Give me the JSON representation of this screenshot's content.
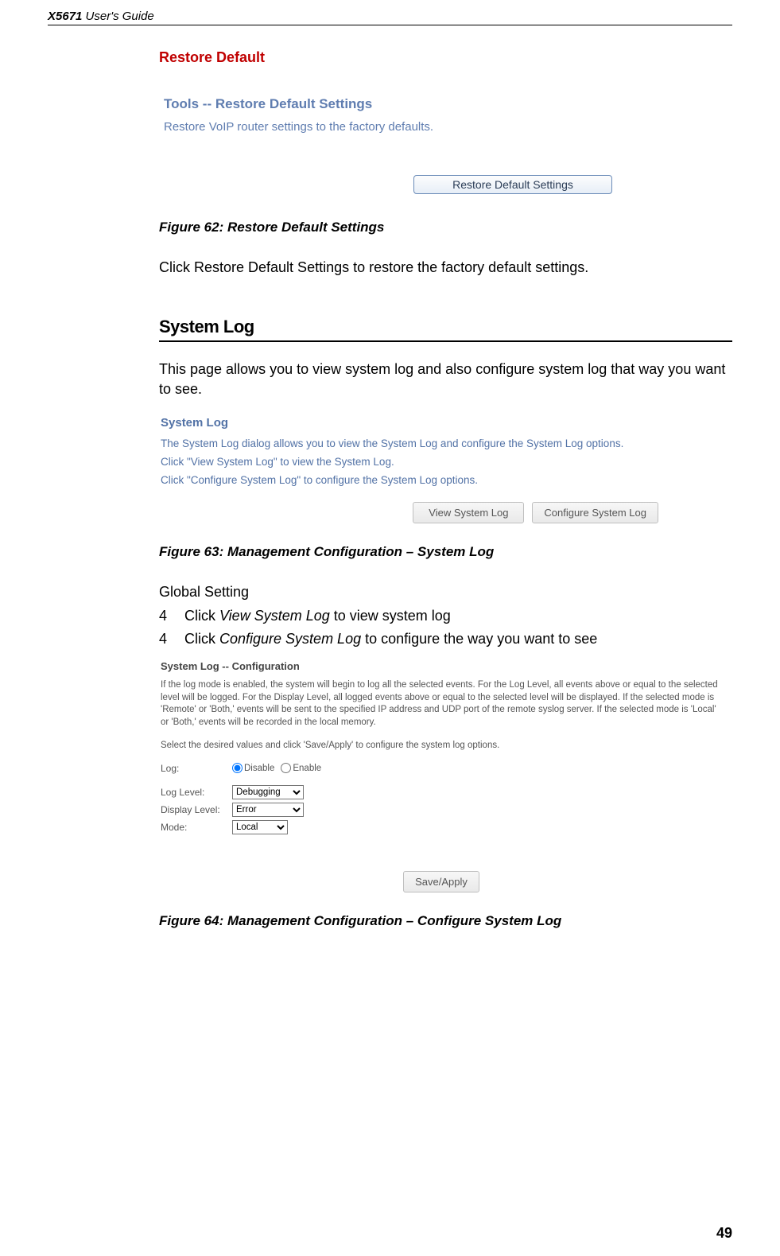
{
  "header": {
    "product": "X5671",
    "suffix": " User's Guide"
  },
  "section1": {
    "title": "Restore Default",
    "shot": {
      "title": "Tools -- Restore Default Settings",
      "body": "Restore VoIP router settings to the factory defaults.",
      "button": "Restore Default Settings"
    },
    "caption": "Figure 62: Restore Default Settings",
    "paragraph": "Click Restore Default Settings to restore the factory default settings."
  },
  "section2": {
    "heading": "System Log",
    "intro": "This page allows you to view system log and also configure system log that way you want to see.",
    "shot": {
      "title": "System Log",
      "line1": "The System Log dialog allows you to view the System Log and configure the System Log options.",
      "line2": "Click \"View System Log\" to view the System Log.",
      "line3": "Click \"Configure System Log\" to configure the System Log options.",
      "btn_view": "View System Log",
      "btn_cfg": "Configure System Log"
    },
    "caption": "Figure 63: Management Configuration – System Log",
    "global_label": "Global Setting",
    "items": [
      {
        "num": "4",
        "pre": "Click ",
        "em": "View System Log",
        "post": " to view system log"
      },
      {
        "num": "4",
        "pre": "Click ",
        "em": "Configure System Log",
        "post": " to configure the way you want to see"
      }
    ],
    "shot_cfg": {
      "title": "System Log -- Configuration",
      "para1": "If the log mode is enabled, the system will begin to log all the selected events. For the Log Level, all events above or equal to the selected level will be logged. For the Display Level, all logged events above or equal to the selected level will be displayed. If the selected mode is 'Remote' or 'Both,' events will be sent to the specified IP address and UDP port of the remote syslog server. If the selected mode is 'Local' or 'Both,' events will be recorded in the local memory.",
      "para2": "Select the desired values and click 'Save/Apply' to configure the system log options.",
      "log_label": "Log:",
      "radio_disable": "Disable",
      "radio_enable": "Enable",
      "loglevel_label": "Log Level:",
      "loglevel_value": "Debugging",
      "displaylevel_label": "Display Level:",
      "displaylevel_value": "Error",
      "mode_label": "Mode:",
      "mode_value": "Local",
      "btn_save": "Save/Apply"
    },
    "caption2": "Figure 64: Management Configuration – Configure System Log"
  },
  "page_number": "49"
}
